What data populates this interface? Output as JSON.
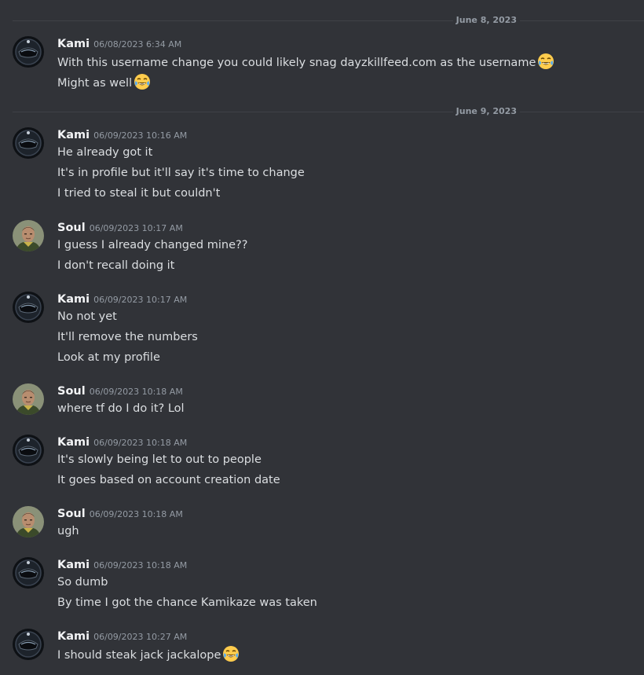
{
  "dividers": [
    "June 8, 2023",
    "June 9, 2023"
  ],
  "groups": [
    {
      "author": "Kami",
      "avatar": "helmet-avatar",
      "time": "06/08/2023 6:34 AM",
      "lines": [
        {
          "text": "With this username change you could likely snag dayzkillfeed.com as the username",
          "emoji": "joy-emoji"
        },
        {
          "text": "Might as well",
          "emoji": "joy-emoji"
        }
      ]
    },
    {
      "author": "Kami",
      "avatar": "helmet-avatar",
      "time": "06/09/2023 10:16 AM",
      "lines": [
        {
          "text": "He already got it"
        },
        {
          "text": "It's in profile but it'll say it's time to change"
        },
        {
          "text": "I tried to steal it but couldn't"
        }
      ]
    },
    {
      "author": "Soul",
      "avatar": "soldier-avatar",
      "time": "06/09/2023 10:17 AM",
      "lines": [
        {
          "text": "I guess I already changed mine??"
        },
        {
          "text": "I don't recall doing it"
        }
      ]
    },
    {
      "author": "Kami",
      "avatar": "helmet-avatar",
      "time": "06/09/2023 10:17 AM",
      "lines": [
        {
          "text": "No not yet"
        },
        {
          "text": "It'll remove the numbers"
        },
        {
          "text": "Look at my profile"
        }
      ]
    },
    {
      "author": "Soul",
      "avatar": "soldier-avatar",
      "time": "06/09/2023 10:18 AM",
      "lines": [
        {
          "text": "where tf do I do it? Lol"
        }
      ]
    },
    {
      "author": "Kami",
      "avatar": "helmet-avatar",
      "time": "06/09/2023 10:18 AM",
      "lines": [
        {
          "text": "It's slowly being let to out to people"
        },
        {
          "text": "It goes based on account creation date"
        }
      ]
    },
    {
      "author": "Soul",
      "avatar": "soldier-avatar",
      "time": "06/09/2023 10:18 AM",
      "lines": [
        {
          "text": "ugh"
        }
      ]
    },
    {
      "author": "Kami",
      "avatar": "helmet-avatar",
      "time": "06/09/2023 10:18 AM",
      "lines": [
        {
          "text": "So dumb"
        },
        {
          "text": "By time I got the chance Kamikaze was taken"
        }
      ]
    },
    {
      "author": "Kami",
      "avatar": "helmet-avatar",
      "time": "06/09/2023 10:27 AM",
      "lines": [
        {
          "text": "I should steak jack jackalope",
          "emoji": "joy-emoji"
        }
      ]
    }
  ],
  "colors": {
    "background": "#313338",
    "username": "#f2f3f5",
    "text": "#dbdee1",
    "muted": "#949ba4"
  }
}
